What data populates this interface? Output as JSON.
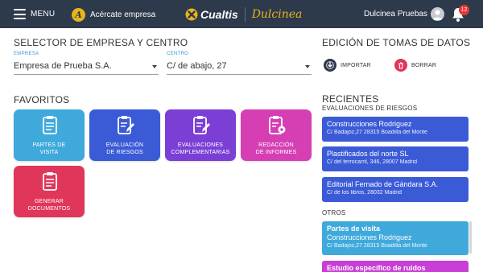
{
  "topbar": {
    "menu_label": "MENU",
    "acercate_label": "Acércate empresa",
    "acercate_badge": "A",
    "brand_cualtis": "Cualtis",
    "brand_dulcinea": "Dulcinea",
    "user_name": "Dulcinea Pruebas",
    "notification_count": "12",
    "bg_color": "#2d3a4c",
    "accent_color": "#e8b41a"
  },
  "selector": {
    "title": "SELECTOR DE EMPRESA Y CENTRO",
    "empresa_label": "EMPRESA",
    "empresa_value": "Empresa de Prueba S.A.",
    "centro_label": "CENTRO",
    "centro_value": "C/ de abajo, 27"
  },
  "favoritos": {
    "title": "FAVORITOS",
    "tiles": [
      {
        "line1": "PARTES DE",
        "line2": "VISITA",
        "color": "#3fa9dc",
        "icon": "clipboard-list-icon"
      },
      {
        "line1": "EVALUACIÓN",
        "line2": "DE RIESGOS",
        "color": "#3b5bd6",
        "icon": "clipboard-edit-icon"
      },
      {
        "line1": "EVALUACIONES",
        "line2": "COMPLEMENTARIAS",
        "color": "#7b3fd6",
        "icon": "clipboard-edit-icon"
      },
      {
        "line1": "REDACCIÓN",
        "line2": "DE INFORMES",
        "color": "#d63fb4",
        "icon": "clipboard-gear-icon"
      },
      {
        "line1": "GENERAR",
        "line2": "DOCUMENTOS",
        "color": "#e0365a",
        "icon": "clipboard-list-icon"
      }
    ]
  },
  "edicion": {
    "title": "EDICIÓN DE TOMAS DE DATOS",
    "importar_label": "IMPORTAR",
    "borrar_label": "BORRAR"
  },
  "recientes": {
    "title": "RECIENTES",
    "subtitle": "EVALUACIONES DE RIESGOS",
    "items": [
      {
        "name": "Construcciones Rodriguez",
        "address": "C/ Badajoz,27 28315 Boadilla del Monte"
      },
      {
        "name": "Plastificados del norte SL",
        "address": "C/ del ferrocarril, 346, 28007 Madrid"
      },
      {
        "name": "Editorial Fernado de Gándara S.A.",
        "address": "C/ de los libros, 28032 Madrid"
      }
    ],
    "card_color": "#3b5bd6"
  },
  "otros": {
    "title": "OTROS",
    "items": [
      {
        "category": "Partes de visita",
        "name": "Construcciones Rodriguez",
        "address": "C/ Badajoz,27 28315 Boadilla del Monte",
        "color": "#3fa9dc"
      },
      {
        "category": "Estudio específico de ruidos",
        "color": "#c83fd6"
      }
    ]
  }
}
